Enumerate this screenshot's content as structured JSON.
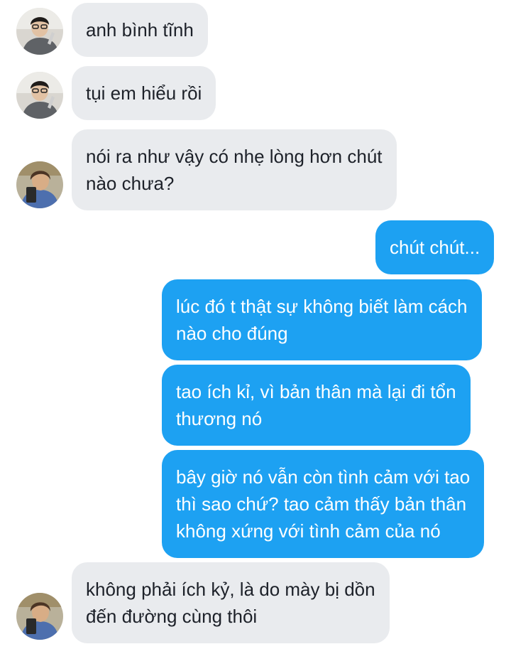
{
  "conversation": {
    "messages": [
      {
        "sender": "contact_a",
        "direction": "incoming",
        "text": "anh bình tĩnh"
      },
      {
        "sender": "contact_a",
        "direction": "incoming",
        "text": "tụi em hiểu rồi"
      },
      {
        "sender": "contact_b",
        "direction": "incoming",
        "text": "nói ra như vậy có nhẹ lòng hơn chút\nnào chưa?"
      },
      {
        "sender": "me",
        "direction": "outgoing",
        "text": "chút chút..."
      },
      {
        "sender": "me",
        "direction": "outgoing",
        "text": "lúc đó t thật sự không biết làm cách\nnào cho đúng"
      },
      {
        "sender": "me",
        "direction": "outgoing",
        "text": "tao ích kỉ, vì bản thân mà lại đi tổn\nthương nó"
      },
      {
        "sender": "me",
        "direction": "outgoing",
        "text": "bây giờ nó vẫn còn tình cảm với tao\nthì sao chứ? tao cảm thấy bản thân\nkhông xứng với tình cảm của nó"
      },
      {
        "sender": "contact_b",
        "direction": "incoming",
        "text": "không phải ích kỷ, là do mày bị dồn\nđến đường cùng thôi"
      }
    ]
  },
  "theme": {
    "incoming_bubble": "#e9ebee",
    "outgoing_bubble": "#1da1f2",
    "incoming_text": "#1d2129",
    "outgoing_text": "#ffffff",
    "background": "#ffffff"
  },
  "avatars": {
    "contact_a": "person-glasses-avatar",
    "contact_b": "person-selfie-avatar"
  }
}
